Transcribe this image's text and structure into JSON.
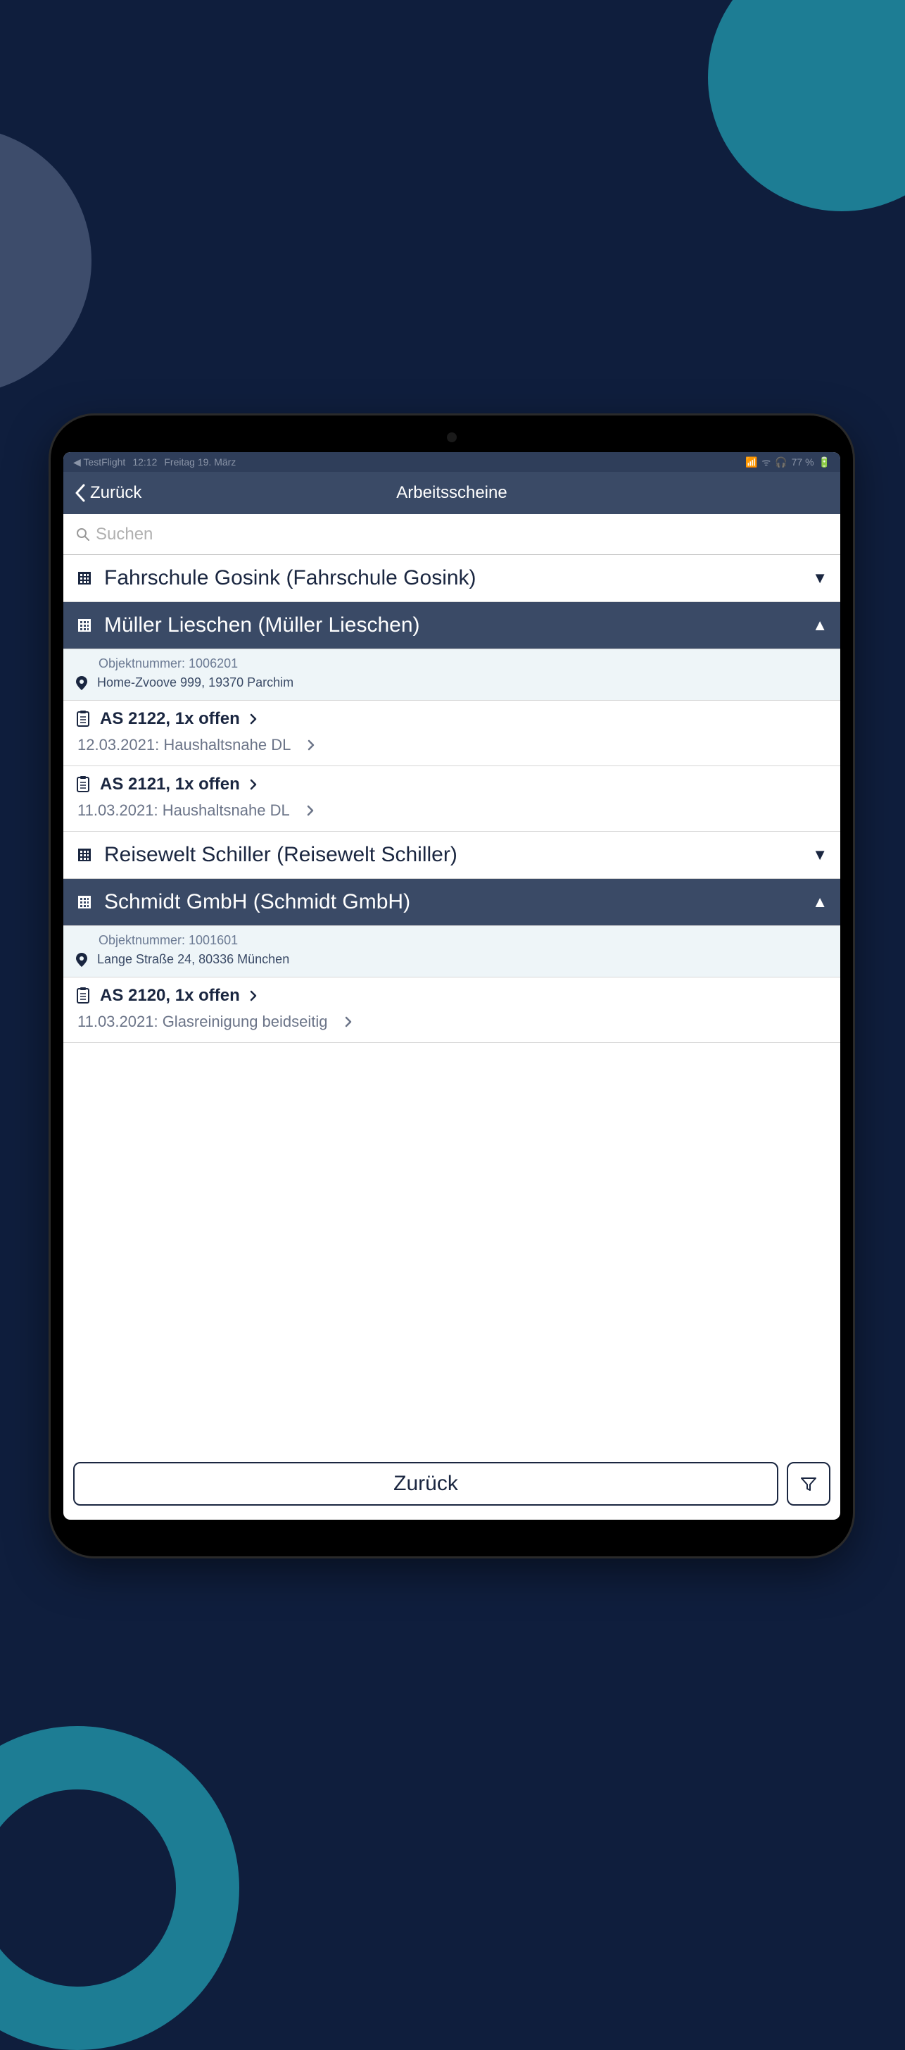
{
  "status": {
    "back_app": "TestFlight",
    "time": "12:12",
    "date": "Freitag 19. März",
    "battery": "77 %"
  },
  "nav": {
    "back": "Zurück",
    "title": "Arbeitsscheine"
  },
  "search": {
    "placeholder": "Suchen"
  },
  "groups": [
    {
      "name": "Fahrschule Gosink (Fahrschule Gosink)",
      "expanded": false
    },
    {
      "name": "Müller Lieschen (Müller Lieschen)",
      "expanded": true,
      "object_number": "Objektnummer: 1006201",
      "address": "Home-Zvoove 999, 19370 Parchim",
      "orders": [
        {
          "title": "AS 2122, 1x offen",
          "detail": "12.03.2021:  Haushaltsnahe DL"
        },
        {
          "title": "AS 2121, 1x offen",
          "detail": "11.03.2021:  Haushaltsnahe DL"
        }
      ]
    },
    {
      "name": "Reisewelt Schiller (Reisewelt Schiller)",
      "expanded": false
    },
    {
      "name": "Schmidt GmbH (Schmidt GmbH)",
      "expanded": true,
      "object_number": "Objektnummer: 1001601",
      "address": "Lange Straße 24, 80336 München",
      "orders": [
        {
          "title": "AS 2120, 1x offen",
          "detail": "11.03.2021:  Glasreinigung beidseitig"
        }
      ]
    }
  ],
  "bottom": {
    "back": "Zurück"
  }
}
